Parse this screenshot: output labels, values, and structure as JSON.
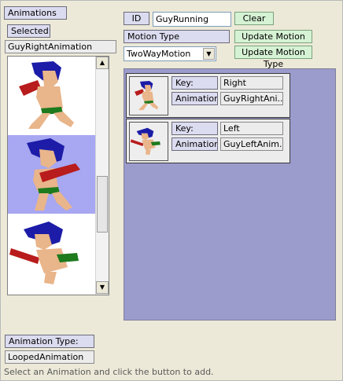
{
  "animations": {
    "header": "Animations",
    "selected_label": "Selected:",
    "selected_value": "GuyRightAnimation",
    "list_items": [
      {
        "name": "guy-right-frame",
        "selected": false
      },
      {
        "name": "guy-idle-frame",
        "selected": true
      },
      {
        "name": "guy-left-frame",
        "selected": false
      }
    ],
    "type_label": "Animation Type:",
    "type_value": "LoopedAnimation"
  },
  "motion": {
    "id_label": "ID",
    "id_value": "GuyRunning",
    "clear_button": "Clear",
    "type_label": "Motion Type",
    "type_value": "TwoWayMotion",
    "update_motion_button": "Update Motion",
    "update_type_button": "Update Motion Type",
    "entries": [
      {
        "key_label": "Key:",
        "key_value": "Right",
        "anim_label": "Animation:",
        "anim_value": "GuyRightAni..."
      },
      {
        "key_label": "Key:",
        "key_value": "Left",
        "anim_label": "Animation:",
        "anim_value": "GuyLeftAnim..."
      }
    ]
  },
  "status_text": "Select an Animation and click the button to add.",
  "icons": {
    "scroll_up": "scroll-up-arrow-icon",
    "scroll_down": "scroll-down-arrow-icon",
    "dropdown": "chevron-down-icon"
  },
  "colors": {
    "label_bg": "#dcdcf0",
    "button_bg": "#d6f2d4",
    "panel_bg": "#9b9bcc",
    "selection_bg": "#a7a7f2"
  }
}
